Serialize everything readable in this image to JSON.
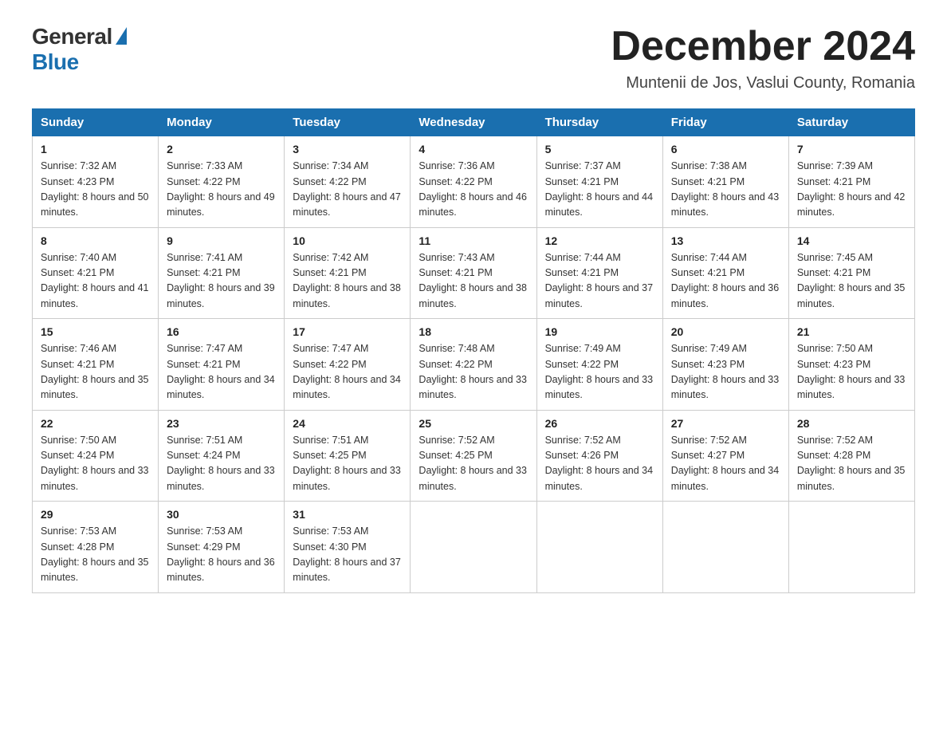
{
  "logo": {
    "general": "General",
    "blue": "Blue"
  },
  "title": "December 2024",
  "location": "Muntenii de Jos, Vaslui County, Romania",
  "days_of_week": [
    "Sunday",
    "Monday",
    "Tuesday",
    "Wednesday",
    "Thursday",
    "Friday",
    "Saturday"
  ],
  "weeks": [
    [
      {
        "day": "1",
        "sunrise": "7:32 AM",
        "sunset": "4:23 PM",
        "daylight": "8 hours and 50 minutes."
      },
      {
        "day": "2",
        "sunrise": "7:33 AM",
        "sunset": "4:22 PM",
        "daylight": "8 hours and 49 minutes."
      },
      {
        "day": "3",
        "sunrise": "7:34 AM",
        "sunset": "4:22 PM",
        "daylight": "8 hours and 47 minutes."
      },
      {
        "day": "4",
        "sunrise": "7:36 AM",
        "sunset": "4:22 PM",
        "daylight": "8 hours and 46 minutes."
      },
      {
        "day": "5",
        "sunrise": "7:37 AM",
        "sunset": "4:21 PM",
        "daylight": "8 hours and 44 minutes."
      },
      {
        "day": "6",
        "sunrise": "7:38 AM",
        "sunset": "4:21 PM",
        "daylight": "8 hours and 43 minutes."
      },
      {
        "day": "7",
        "sunrise": "7:39 AM",
        "sunset": "4:21 PM",
        "daylight": "8 hours and 42 minutes."
      }
    ],
    [
      {
        "day": "8",
        "sunrise": "7:40 AM",
        "sunset": "4:21 PM",
        "daylight": "8 hours and 41 minutes."
      },
      {
        "day": "9",
        "sunrise": "7:41 AM",
        "sunset": "4:21 PM",
        "daylight": "8 hours and 39 minutes."
      },
      {
        "day": "10",
        "sunrise": "7:42 AM",
        "sunset": "4:21 PM",
        "daylight": "8 hours and 38 minutes."
      },
      {
        "day": "11",
        "sunrise": "7:43 AM",
        "sunset": "4:21 PM",
        "daylight": "8 hours and 38 minutes."
      },
      {
        "day": "12",
        "sunrise": "7:44 AM",
        "sunset": "4:21 PM",
        "daylight": "8 hours and 37 minutes."
      },
      {
        "day": "13",
        "sunrise": "7:44 AM",
        "sunset": "4:21 PM",
        "daylight": "8 hours and 36 minutes."
      },
      {
        "day": "14",
        "sunrise": "7:45 AM",
        "sunset": "4:21 PM",
        "daylight": "8 hours and 35 minutes."
      }
    ],
    [
      {
        "day": "15",
        "sunrise": "7:46 AM",
        "sunset": "4:21 PM",
        "daylight": "8 hours and 35 minutes."
      },
      {
        "day": "16",
        "sunrise": "7:47 AM",
        "sunset": "4:21 PM",
        "daylight": "8 hours and 34 minutes."
      },
      {
        "day": "17",
        "sunrise": "7:47 AM",
        "sunset": "4:22 PM",
        "daylight": "8 hours and 34 minutes."
      },
      {
        "day": "18",
        "sunrise": "7:48 AM",
        "sunset": "4:22 PM",
        "daylight": "8 hours and 33 minutes."
      },
      {
        "day": "19",
        "sunrise": "7:49 AM",
        "sunset": "4:22 PM",
        "daylight": "8 hours and 33 minutes."
      },
      {
        "day": "20",
        "sunrise": "7:49 AM",
        "sunset": "4:23 PM",
        "daylight": "8 hours and 33 minutes."
      },
      {
        "day": "21",
        "sunrise": "7:50 AM",
        "sunset": "4:23 PM",
        "daylight": "8 hours and 33 minutes."
      }
    ],
    [
      {
        "day": "22",
        "sunrise": "7:50 AM",
        "sunset": "4:24 PM",
        "daylight": "8 hours and 33 minutes."
      },
      {
        "day": "23",
        "sunrise": "7:51 AM",
        "sunset": "4:24 PM",
        "daylight": "8 hours and 33 minutes."
      },
      {
        "day": "24",
        "sunrise": "7:51 AM",
        "sunset": "4:25 PM",
        "daylight": "8 hours and 33 minutes."
      },
      {
        "day": "25",
        "sunrise": "7:52 AM",
        "sunset": "4:25 PM",
        "daylight": "8 hours and 33 minutes."
      },
      {
        "day": "26",
        "sunrise": "7:52 AM",
        "sunset": "4:26 PM",
        "daylight": "8 hours and 34 minutes."
      },
      {
        "day": "27",
        "sunrise": "7:52 AM",
        "sunset": "4:27 PM",
        "daylight": "8 hours and 34 minutes."
      },
      {
        "day": "28",
        "sunrise": "7:52 AM",
        "sunset": "4:28 PM",
        "daylight": "8 hours and 35 minutes."
      }
    ],
    [
      {
        "day": "29",
        "sunrise": "7:53 AM",
        "sunset": "4:28 PM",
        "daylight": "8 hours and 35 minutes."
      },
      {
        "day": "30",
        "sunrise": "7:53 AM",
        "sunset": "4:29 PM",
        "daylight": "8 hours and 36 minutes."
      },
      {
        "day": "31",
        "sunrise": "7:53 AM",
        "sunset": "4:30 PM",
        "daylight": "8 hours and 37 minutes."
      },
      null,
      null,
      null,
      null
    ]
  ]
}
